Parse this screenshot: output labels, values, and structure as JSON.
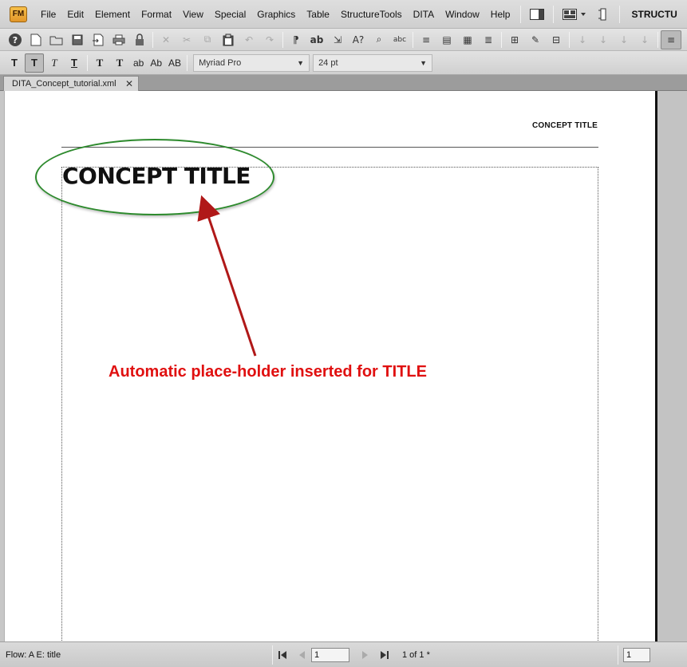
{
  "menubar": {
    "logo": "FM",
    "items": [
      "File",
      "Edit",
      "Element",
      "Format",
      "View",
      "Special",
      "Graphics",
      "Table",
      "StructureTools",
      "DITA",
      "Window",
      "Help"
    ],
    "workspace_label": "STRUCTU"
  },
  "toolbar1": {
    "icons": [
      "help-icon",
      "new-document-icon",
      "open-folder-icon",
      "save-icon",
      "import-icon",
      "print-icon",
      "lock-icon",
      "delete-icon",
      "cut-icon",
      "copy-icon",
      "paste-icon",
      "undo-icon",
      "redo-icon",
      "quotes-icon",
      "spelling-icon",
      "insert-cross-ref-icon",
      "find-icon",
      "search-icon",
      "spell-check-icon",
      "align-center-icon",
      "paragraph-icon",
      "table-icon",
      "align-justify-icon",
      "insert-element-icon",
      "edit-attributes-icon",
      "element-catalog-icon",
      "arrow-down-icon",
      "arrow-down-icon",
      "arrow-down-icon",
      "arrow-down-icon",
      "align-left-icon"
    ],
    "glyphs": [
      "?",
      "🗋",
      "🗁",
      "💾",
      "⇲",
      "⎙",
      "🔒",
      "✕",
      "✂",
      "⧉",
      "📋",
      "↶",
      "↷",
      "⁋",
      "ab",
      "⇲",
      "A?",
      "⌕",
      "abc",
      "≡",
      "▤",
      "▦",
      "≣",
      "⊞",
      "✎",
      "⊟",
      "↓",
      "↓",
      "↓",
      "↓",
      "≡"
    ]
  },
  "toolbar2": {
    "format_buttons": [
      "T",
      "T",
      "T",
      "T",
      "T",
      "T"
    ],
    "case_buttons": [
      "ab",
      "Ab",
      "AB"
    ],
    "font_family": "Myriad Pro",
    "font_size": "24 pt"
  },
  "tab": {
    "label": "DITA_Concept_tutorial.xml",
    "close": "✕"
  },
  "document": {
    "header_title": "CONCEPT TITLE",
    "concept_title": "CONCEPT TITLE",
    "annotation": "Automatic place-holder inserted for TITLE",
    "colors": {
      "annotation_text": "#e01010",
      "ellipse": "#2d8a2d",
      "arrow": "#b01818"
    }
  },
  "statusbar": {
    "flow": "Flow: A  E: title",
    "page_value": "1",
    "page_count": "1 of 1 *",
    "zoom_value": "1"
  }
}
